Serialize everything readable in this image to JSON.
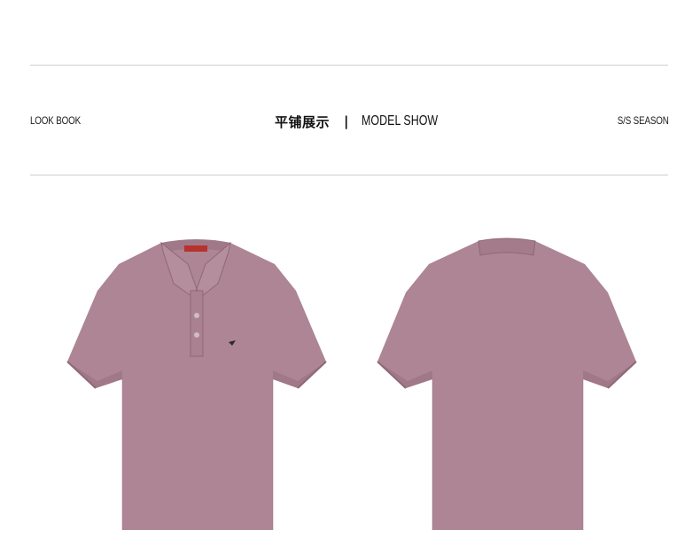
{
  "header": {
    "left_label": "LOOK BOOK",
    "title_cn": "平铺展示",
    "separator": "|",
    "title_en": "MODEL SHOW",
    "right_label": "S/S SEASON"
  },
  "colors": {
    "shirt": "#ad8595",
    "shirt_shadow": "#97707f",
    "rule": "#cfcfcf",
    "label_tag": "#b7322c"
  },
  "images": {
    "front": "polo-shirt-front",
    "back": "polo-shirt-back"
  }
}
